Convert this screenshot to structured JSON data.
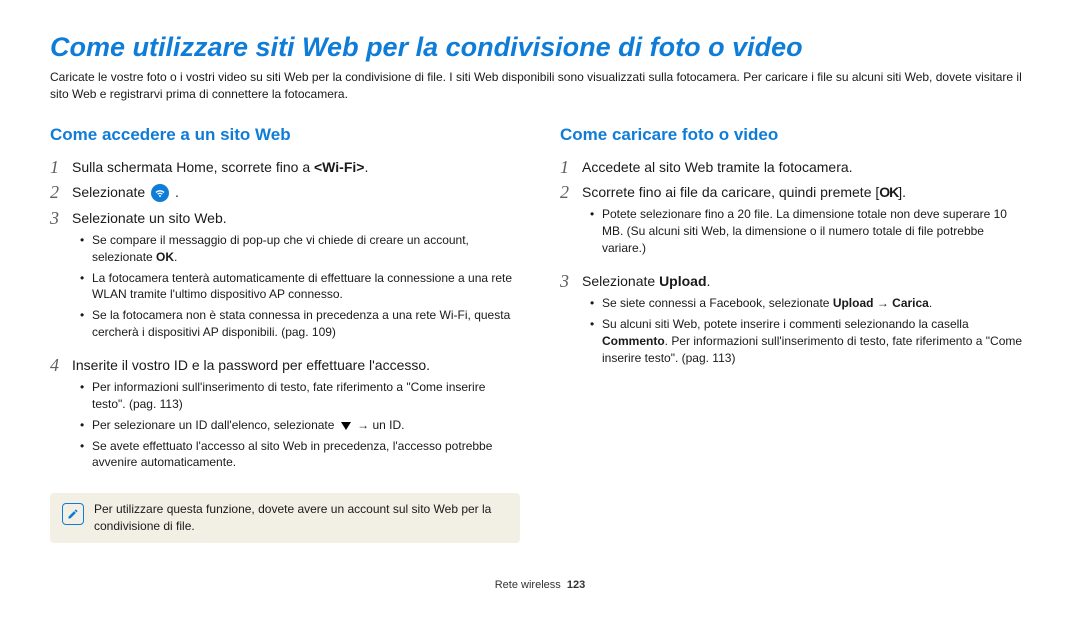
{
  "title": "Come utilizzare siti Web per la condivisione di foto o video",
  "intro": "Caricate le vostre foto o i vostri video su siti Web per la condivisione di file. I siti Web disponibili sono visualizzati sulla fotocamera. Per caricare i file su alcuni siti Web, dovete visitare il sito Web e registrarvi prima di connettere la fotocamera.",
  "left": {
    "heading": "Come accedere a un sito Web",
    "s1_pre": "Sulla schermata Home, scorrete fino a ",
    "s1_bold": "<Wi-Fi>",
    "s1_post": ".",
    "s2_pre": "Selezionate ",
    "s2_post": ".",
    "s3": "Selezionate un sito Web.",
    "s3_b1_pre": "Se compare il messaggio di pop-up che vi chiede di creare un account, selezionate ",
    "s3_b1_bold": "OK",
    "s3_b1_post": ".",
    "s3_b2": "La fotocamera tenterà automaticamente di effettuare la connessione a una rete WLAN tramite l'ultimo dispositivo AP connesso.",
    "s3_b3": "Se la fotocamera non è stata connessa in precedenza a una rete Wi-Fi, questa cercherà i dispositivi AP disponibili. (pag. 109)",
    "s4": "Inserite il vostro ID e la password per effettuare l'accesso.",
    "s4_b1": "Per informazioni sull'inserimento di testo, fate riferimento a \"Come inserire testo\". (pag. 113)",
    "s4_b2_pre": "Per selezionare un ID dall'elenco, selezionate ",
    "s4_b2_post": " → un ID.",
    "s4_b3": "Se avete effettuato l'accesso al sito Web in precedenza, l'accesso potrebbe avvenire automaticamente.",
    "note": "Per utilizzare questa funzione, dovete avere un account sul sito Web per la condivisione di file."
  },
  "right": {
    "heading": "Come caricare foto o video",
    "s1": "Accedete al sito Web tramite la fotocamera.",
    "s2_pre": "Scorrete fino ai file da caricare, quindi premete [",
    "s2_post": "].",
    "s2_b1": "Potete selezionare fino a 20 file. La dimensione totale non deve superare 10 MB. (Su alcuni siti Web, la dimensione o il numero totale di file potrebbe variare.)",
    "s3_pre": "Selezionate ",
    "s3_bold": "Upload",
    "s3_post": ".",
    "s3_b1_pre": "Se siete connessi a Facebook, selezionate ",
    "s3_b1_bold1": "Upload",
    "s3_b1_mid": " → ",
    "s3_b1_bold2": "Carica",
    "s3_b1_post": ".",
    "s3_b2_pre": "Su alcuni siti Web, potete inserire i commenti selezionando la casella ",
    "s3_b2_bold": "Commento",
    "s3_b2_post": ". Per informazioni sull'inserimento di testo, fate riferimento a \"Come inserire testo\". (pag. 113)"
  },
  "footer": {
    "section": "Rete wireless",
    "page": "123"
  },
  "icons": {
    "wifi": "wifi-icon",
    "ok": "OK",
    "down": "down-triangle-icon",
    "note": "pencil-note-icon"
  }
}
